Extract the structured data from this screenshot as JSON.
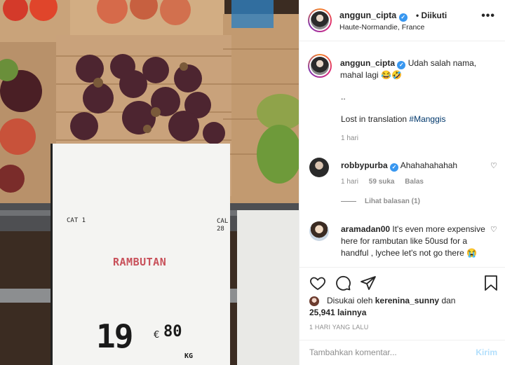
{
  "post": {
    "username": "anggun_cipta",
    "follow_separator": "•",
    "follow_label": "Diikuti",
    "location": "Haute-Normandie, France",
    "more_icon": "more-icon"
  },
  "photo_sign": {
    "cat_left": "CAT 1",
    "cat_right_line1": "CAL",
    "cat_right_line2": "28",
    "product_name": "RAMBUTAN",
    "price_whole": "19",
    "currency": "€",
    "price_cents": "80",
    "unit": "KG"
  },
  "caption": {
    "username": "anggun_cipta",
    "text": "Udah salah nama, mahal lagi 😂🤣",
    "dots": "..",
    "line2_prefix": "Lost in translation",
    "hashtag": "#Manggis",
    "time": "1 hari"
  },
  "comments": [
    {
      "username": "robbypurba",
      "text": "Ahahahahahah",
      "time": "1 hari",
      "likes": "59 suka",
      "reply": "Balas",
      "view_replies": "Lihat balasan (1)"
    },
    {
      "username": "aramadan00",
      "text": "It's even more expensive here for rambutan like 50usd for a handful , lychee let's not go there 😭"
    }
  ],
  "actions": {
    "like_icon": "heart-icon",
    "comment_icon": "comment-icon",
    "share_icon": "share-icon",
    "save_icon": "bookmark-icon"
  },
  "likes": {
    "prefix": "Disukai oleh",
    "by": "kerenina_sunny",
    "and": "dan",
    "count": "25,941 lainnya"
  },
  "timestamp": "1 HARI YANG LALU",
  "add_comment": {
    "placeholder": "Tambahkan komentar...",
    "post_label": "Kirim"
  },
  "colors": {
    "verified": "#3897f0",
    "hashtag": "#00376b",
    "post_disabled": "#b2dffc",
    "secondary_text": "#8e8e8e"
  }
}
